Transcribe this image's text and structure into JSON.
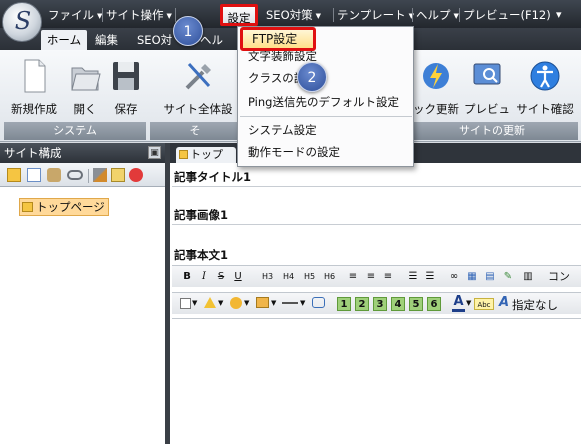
{
  "app": {
    "logo_glyph": "S"
  },
  "menubar": {
    "file": "ファイル",
    "site_ops": "サイト操作",
    "settings": "設定",
    "seo": "SEO対策",
    "template": "テンプレート",
    "help": "ヘルプ",
    "preview": "プレビュー(F12)",
    "overflow": "▾"
  },
  "tabs": {
    "home": "ホーム",
    "edit": "編集",
    "seo": "SEO対",
    "more": "ヘル"
  },
  "ribbon": {
    "new": "新規作成",
    "open": "開く",
    "save": "保存",
    "site_all": "サイト全体設",
    "quick_update": "ック更新",
    "preview": "プレビュー",
    "site_check": "サイト確認",
    "group_system": "システム",
    "group_partial": "そ",
    "group_update": "サイトの更新"
  },
  "site_panel": {
    "title": "サイト構成",
    "pin": "▣",
    "tree_root": "トップページ"
  },
  "editor": {
    "tab_label": "トップ",
    "field_title": "記事タイトル1",
    "field_image": "記事画像1",
    "field_body": "記事本文1",
    "toolbar1": [
      "B",
      "I",
      "S",
      "U",
      "H3",
      "H4",
      "H5",
      "H6",
      "≡",
      "≡",
      "≡",
      "☰",
      "☰",
      "∞",
      "▦",
      "▤",
      "✎",
      "▥",
      "コン"
    ],
    "toolbar2_nums": [
      "1",
      "2",
      "3",
      "4",
      "5",
      "6"
    ],
    "toolbar2_label": "指定なし",
    "toolbar2_abc": "Abc"
  },
  "dropdown": {
    "ftp": "FTP設定",
    "text_style": "文字装飾設定",
    "class": "クラスの設定",
    "ping": "Ping送信先のデフォルト設定",
    "system": "システム設定",
    "mode": "動作モードの設定"
  },
  "annotations": {
    "step1": "1",
    "step2": "2"
  },
  "colors": {
    "highlight_red": "#e01010",
    "menubar_dark": "#2b3037",
    "folder_yellow": "#f5c542",
    "badge_blue": "#3a5fb0"
  }
}
